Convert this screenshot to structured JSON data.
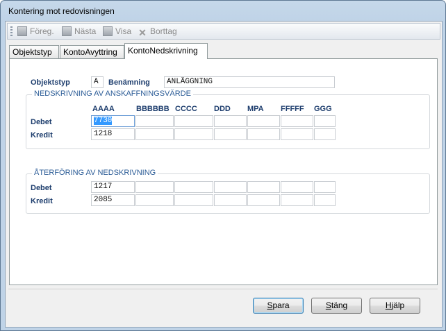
{
  "window": {
    "title": "Kontering mot redovisningen"
  },
  "toolbar": {
    "items": [
      {
        "label": "Föreg.",
        "icon": "document-icon"
      },
      {
        "label": "Nästa",
        "icon": "document-icon"
      },
      {
        "label": "Visa",
        "icon": "document-icon"
      },
      {
        "label": "Borttag",
        "icon": "delete-x-icon"
      }
    ]
  },
  "tabs": [
    "Objektstyp",
    "KontoAvyttring",
    "KontoNedskrivning"
  ],
  "active_tab": "KontoNedskrivning",
  "form": {
    "objektstyp_label": "Objektstyp",
    "objektstyp_value": "A",
    "benamning_label": "Benämning",
    "benamning_value": "ANLÄGGNING"
  },
  "group1": {
    "title": "NEDSKRIVNING AV ANSKAFFNINGSVÄRDE",
    "columns": [
      "AAAA",
      "BBBBBB",
      "CCCC",
      "DDD",
      "MPA",
      "FFFFF",
      "GGG"
    ],
    "rows": [
      {
        "label": "Debet",
        "values": [
          "7730",
          "",
          "",
          "",
          "",
          "",
          ""
        ]
      },
      {
        "label": "Kredit",
        "values": [
          "1218",
          "",
          "",
          "",
          "",
          "",
          ""
        ]
      }
    ]
  },
  "group2": {
    "title": "ÅTERFÖRING AV NEDSKRIVNING",
    "rows": [
      {
        "label": "Debet",
        "values": [
          "1217",
          "",
          "",
          "",
          "",
          "",
          ""
        ]
      },
      {
        "label": "Kredit",
        "values": [
          "2085",
          "",
          "",
          "",
          "",
          "",
          ""
        ]
      }
    ]
  },
  "buttons": {
    "spara": {
      "underline": "S",
      "rest": "para"
    },
    "stang": {
      "underline": "S",
      "rest": "täng"
    },
    "hjalp": {
      "underline": "H",
      "rest": "jälp"
    }
  },
  "colors": {
    "label_text": "#1d3d6d",
    "group_title": "#2a5b96",
    "selection": "#3399ff"
  }
}
